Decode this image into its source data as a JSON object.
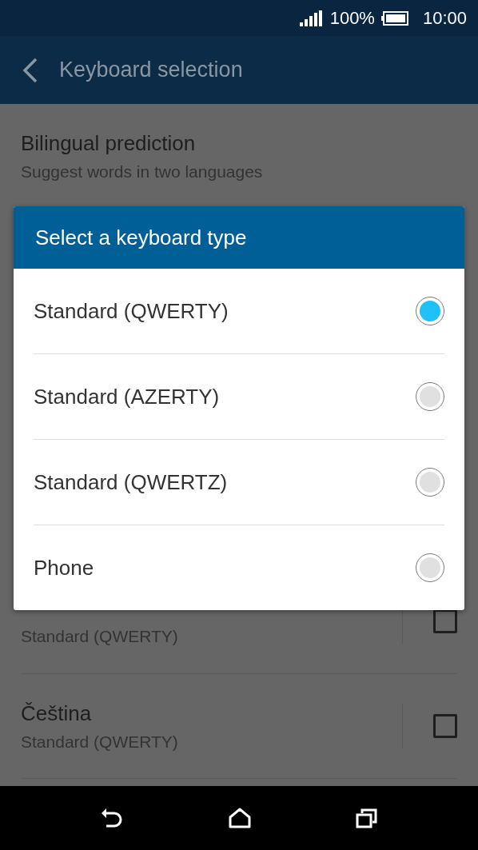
{
  "status_bar": {
    "battery": "100%",
    "time": "10:00"
  },
  "header": {
    "title": "Keyboard selection"
  },
  "settings": [
    {
      "kind": "text",
      "title": "Bilingual prediction",
      "subtitle": "Suggest words in two languages"
    },
    {
      "kind": "checkbox",
      "subtitle": "Standard (QWERTY)",
      "checked": false
    },
    {
      "kind": "checkbox",
      "title": "Čeština",
      "subtitle": "Standard (QWERTY)",
      "checked": false
    }
  ],
  "dialog": {
    "title": "Select a keyboard type",
    "options": [
      {
        "label": "Standard (QWERTY)",
        "selected": true
      },
      {
        "label": "Standard (AZERTY)",
        "selected": false
      },
      {
        "label": "Standard (QWERTZ)",
        "selected": false
      },
      {
        "label": "Phone",
        "selected": false
      }
    ]
  }
}
